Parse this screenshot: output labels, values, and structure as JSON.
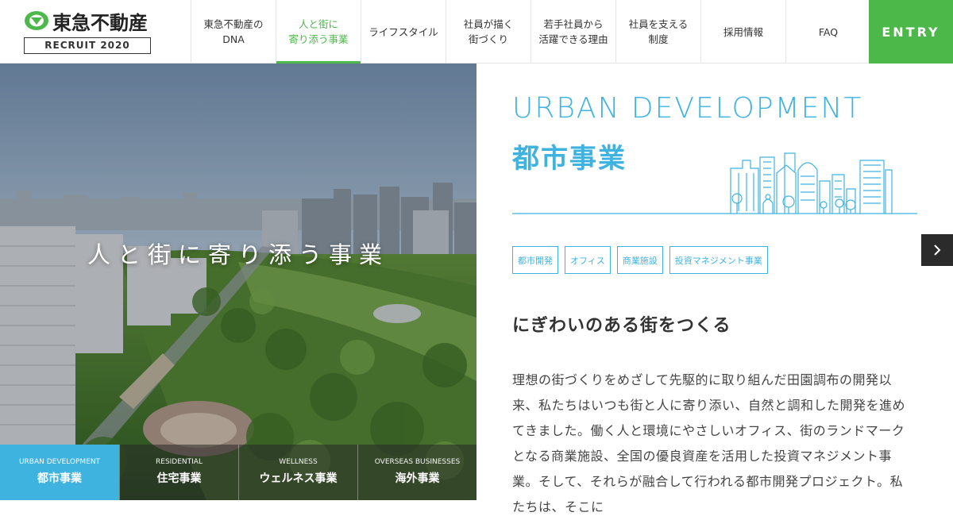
{
  "header": {
    "logo_text": "東急不動産",
    "recruit_label": "RECRUIT 2020",
    "nav": [
      {
        "label": "東急不動産の\nDNA"
      },
      {
        "label": "人と街に\n寄り添う事業"
      },
      {
        "label": "ライフスタイル"
      },
      {
        "label": "社員が描く\n街づくり"
      },
      {
        "label": "若手社員から\n活躍できる理由"
      },
      {
        "label": "社員を支える\n制度"
      },
      {
        "label": "採用情報"
      },
      {
        "label": "FAQ"
      }
    ],
    "entry_label": "ENTRY"
  },
  "hero": {
    "caption": "人と街に寄り添う事業",
    "tabs": [
      {
        "en": "URBAN DEVELOPMENT",
        "ja": "都市事業"
      },
      {
        "en": "RESIDENTIAL",
        "ja": "住宅事業"
      },
      {
        "en": "WELLNESS",
        "ja": "ウェルネス事業"
      },
      {
        "en": "OVERSEAS BUSINESSES",
        "ja": "海外事業"
      }
    ]
  },
  "content": {
    "en_title": "URBAN DEVELOPMENT",
    "ja_title": "都市事業",
    "tags": [
      "都市開発",
      "オフィス",
      "商業施設",
      "投資マネジメント事業"
    ],
    "headline": "にぎわいのある街をつくる",
    "body": "理想の街づくりをめざして先駆的に取り組んだ田園調布の開発以来、私たちはいつも街と人に寄り添い、自然と調和した開発を進めてきました。働く人と環境にやさしいオフィス、街のランドマークとなる商業施設、全国の優良資産を活用した投資マネジメント事業。そして、それらが融合して行われる都市開発プロジェクト。私たちは、そこに"
  },
  "colors": {
    "accent_green": "#4db84a",
    "accent_blue": "#3fb3e0",
    "text": "#333333"
  },
  "icons": {
    "next": "chevron-right-icon",
    "logo": "tokyu-logo-icon"
  }
}
